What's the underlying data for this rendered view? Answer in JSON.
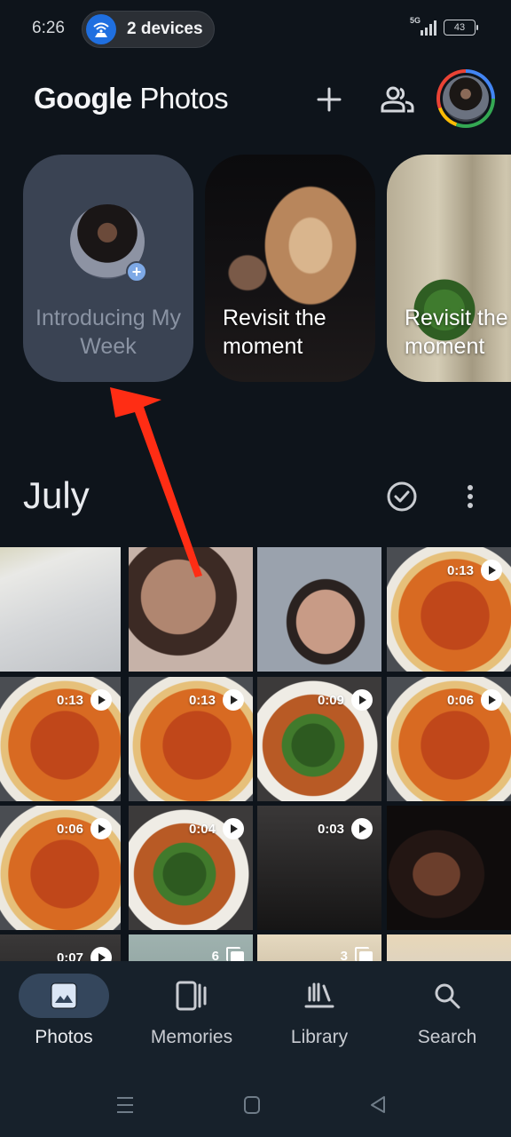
{
  "status_bar": {
    "time": "6:26",
    "hotspot_label": "2 devices",
    "network_type": "5G",
    "battery_level": "43"
  },
  "header": {
    "logo_google": "Google",
    "logo_photos": "Photos",
    "add_icon": "plus-icon",
    "sharing_icon": "people-icon",
    "account_icon": "profile-avatar"
  },
  "stories": [
    {
      "title": "Introducing My Week",
      "type": "my-week"
    },
    {
      "title": "Revisit the moment",
      "type": "memory"
    },
    {
      "title": "Revisit the moment",
      "type": "memory"
    }
  ],
  "section": {
    "title": "July",
    "select_icon": "check-circle-icon",
    "more_icon": "more-vert-icon"
  },
  "grid": {
    "items": [
      {
        "kind": "photo"
      },
      {
        "kind": "photo"
      },
      {
        "kind": "photo"
      },
      {
        "kind": "video",
        "duration": "0:13"
      },
      {
        "kind": "video",
        "duration": "0:13"
      },
      {
        "kind": "video",
        "duration": "0:13"
      },
      {
        "kind": "video",
        "duration": "0:09"
      },
      {
        "kind": "video",
        "duration": "0:06"
      },
      {
        "kind": "video",
        "duration": "0:06"
      },
      {
        "kind": "video",
        "duration": "0:04"
      },
      {
        "kind": "video",
        "duration": "0:03"
      },
      {
        "kind": "photo"
      },
      {
        "kind": "video",
        "duration": "0:07"
      },
      {
        "kind": "stack",
        "count": "6"
      },
      {
        "kind": "stack",
        "count": "3"
      },
      {
        "kind": "photo"
      }
    ]
  },
  "bottom_nav": {
    "items": [
      {
        "label": "Photos",
        "icon": "photo-icon",
        "active": true
      },
      {
        "label": "Memories",
        "icon": "memories-icon",
        "active": false
      },
      {
        "label": "Library",
        "icon": "library-icon",
        "active": false
      },
      {
        "label": "Search",
        "icon": "search-icon",
        "active": false
      }
    ]
  },
  "annotation": {
    "arrow_color": "#ff2d14",
    "target": "Introducing My Week"
  },
  "colors": {
    "background": "#0e141b",
    "nav_background": "#17212b",
    "active_pill": "#34465c",
    "my_week_card": "#3a4353",
    "hotspot_blue": "#1f6fe0"
  }
}
